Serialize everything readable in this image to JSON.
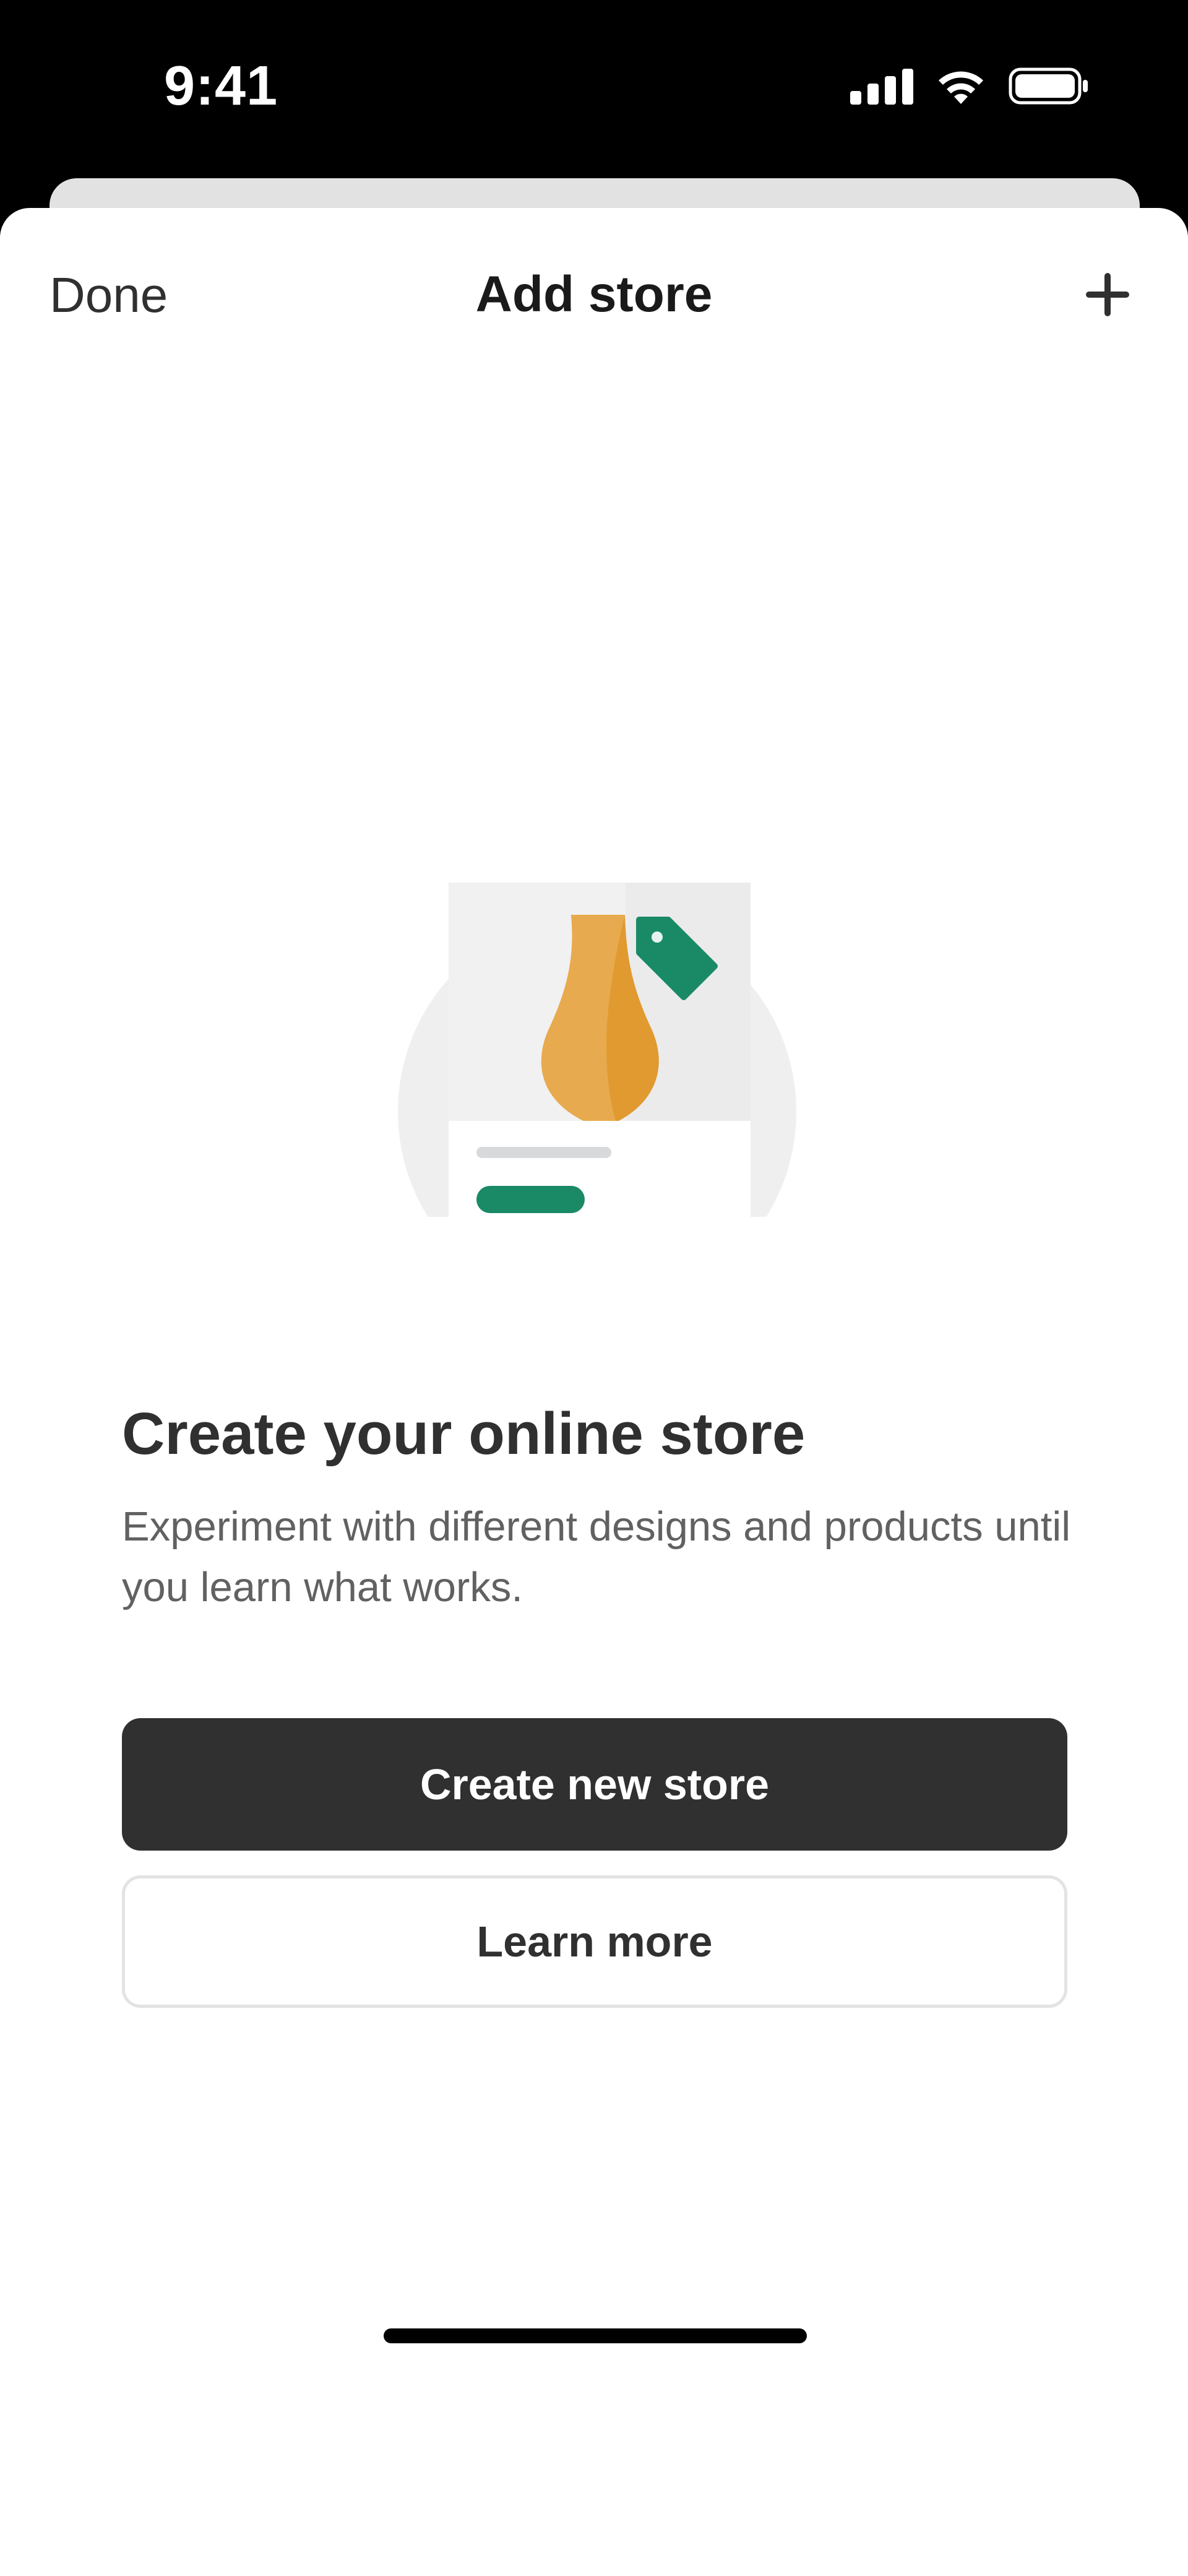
{
  "status_bar": {
    "time": "9:41",
    "icons": [
      "signal-icon",
      "wifi-icon",
      "battery-icon"
    ]
  },
  "nav": {
    "done_label": "Done",
    "title": "Add store",
    "add_icon": "plus-icon"
  },
  "empty_state": {
    "illustration": "store-vase-illustration",
    "headline": "Create your online store",
    "description": "Experiment with different designs and products until you learn what works.",
    "primary_button_label": "Create new store",
    "secondary_button_label": "Learn more"
  },
  "colors": {
    "primary_button": "#303030",
    "accent_green": "#1a8a66",
    "vase_orange": "#e8a446"
  }
}
